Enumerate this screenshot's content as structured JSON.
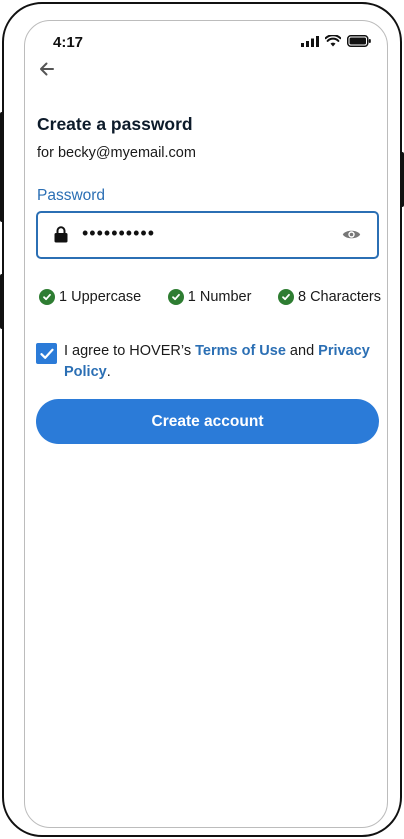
{
  "status_bar": {
    "time": "4:17"
  },
  "header": {
    "title": "Create a password",
    "subtitle": "for becky@myemail.com"
  },
  "password": {
    "label": "Password",
    "value": "••••••••••"
  },
  "requirements": [
    {
      "label": "1 Uppercase",
      "met": true
    },
    {
      "label": "1 Number",
      "met": true
    },
    {
      "label": "8 Characters",
      "met": true
    }
  ],
  "agreement": {
    "checked": true,
    "prefix": "I agree to HOVER’s ",
    "terms_link": "Terms of Use",
    "and": " and ",
    "privacy_link": "Privacy Policy",
    "suffix": "."
  },
  "cta": {
    "label": "Create account"
  },
  "colors": {
    "accent": "#2b7bd8",
    "label_blue": "#2b6fb4",
    "success": "#2e7d32",
    "title": "#0d1b2a"
  }
}
